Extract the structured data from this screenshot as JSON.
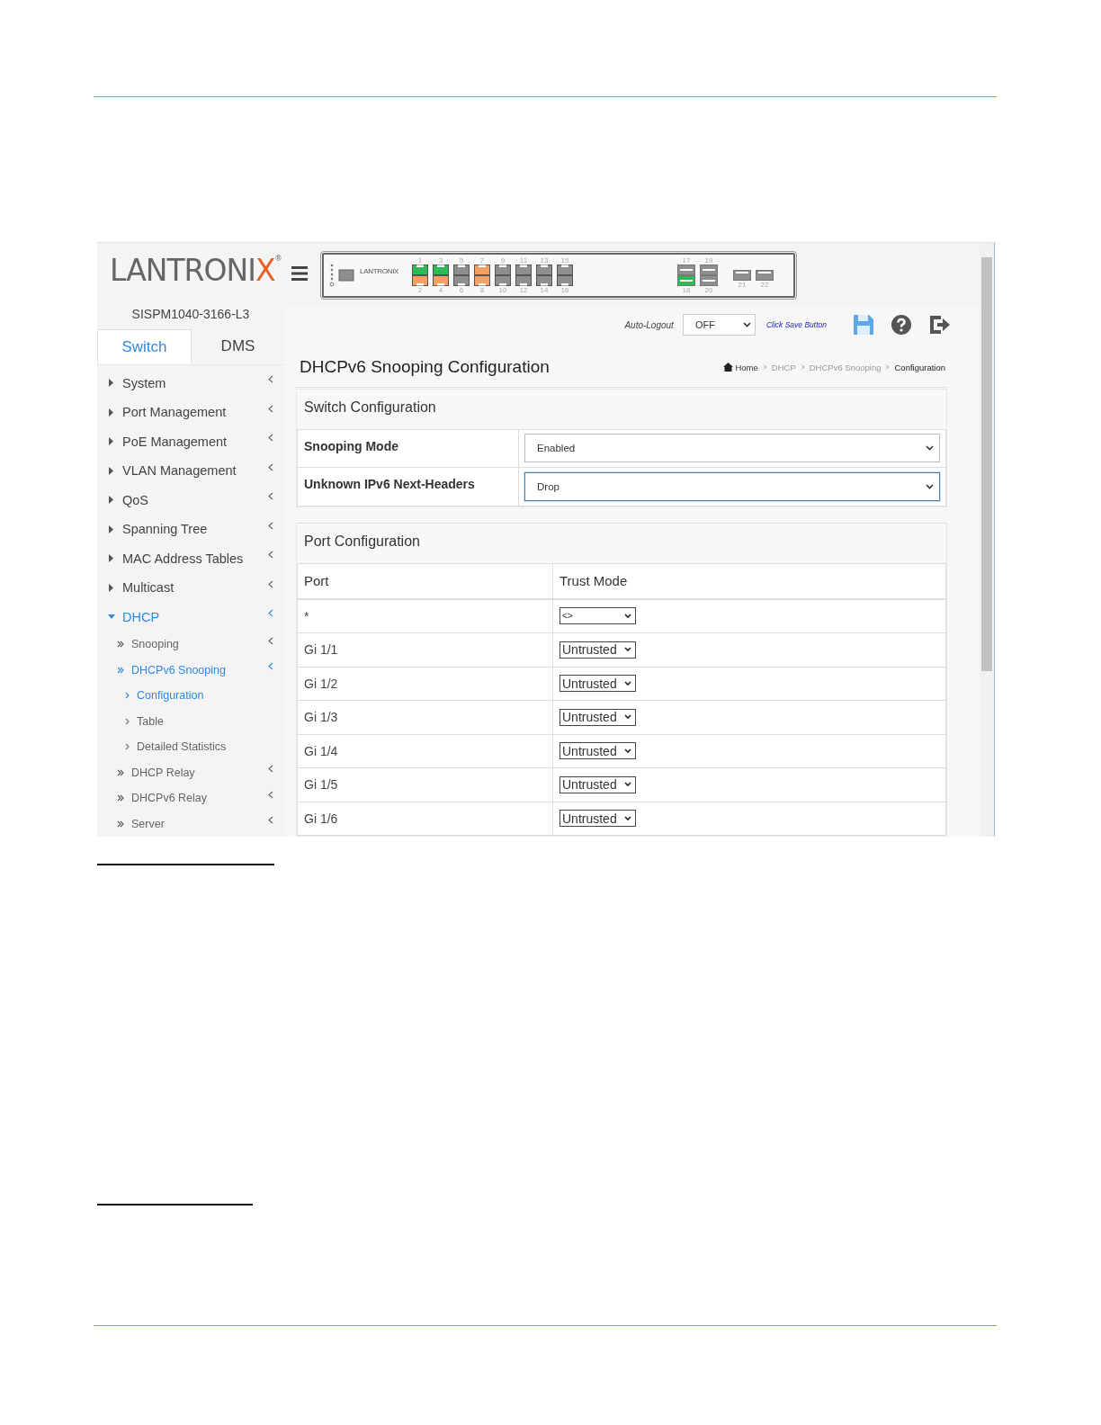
{
  "logo": {
    "text": "LANTRONI",
    "accent": "X",
    "mark": "®"
  },
  "switch_panel": {
    "logo_text": "LANTRONIX",
    "port_columns": [
      {
        "kind": "rj45",
        "top": {
          "label": "1",
          "color": "#2dbb55"
        },
        "bottom": {
          "label": "2",
          "color": "#f4a062"
        }
      },
      {
        "kind": "rj45",
        "top": {
          "label": "3",
          "color": "#2dbb55"
        },
        "bottom": {
          "label": "4",
          "color": "#f4a062"
        }
      },
      {
        "kind": "rj45",
        "top": {
          "label": "5",
          "color": "#8e8e8e"
        },
        "bottom": {
          "label": "6",
          "color": "#8e8e8e"
        }
      },
      {
        "kind": "rj45",
        "top": {
          "label": "7",
          "color": "#f4a062"
        },
        "bottom": {
          "label": "8",
          "color": "#f4a062"
        }
      },
      {
        "kind": "rj45",
        "top": {
          "label": "9",
          "color": "#8e8e8e"
        },
        "bottom": {
          "label": "10",
          "color": "#8e8e8e"
        }
      },
      {
        "kind": "rj45",
        "top": {
          "label": "11",
          "color": "#8e8e8e"
        },
        "bottom": {
          "label": "12",
          "color": "#8e8e8e"
        }
      },
      {
        "kind": "rj45",
        "top": {
          "label": "13",
          "color": "#8e8e8e"
        },
        "bottom": {
          "label": "14",
          "color": "#8e8e8e"
        }
      },
      {
        "kind": "rj45",
        "top": {
          "label": "15",
          "color": "#8e8e8e"
        },
        "bottom": {
          "label": "16",
          "color": "#8e8e8e"
        }
      },
      {
        "kind": "sfp",
        "top": {
          "label": "17",
          "color": "#8e8e8e"
        },
        "bottom": {
          "label": "18",
          "color": "#2dbb55"
        }
      },
      {
        "kind": "sfp",
        "top": {
          "label": "19",
          "color": "#8e8e8e"
        },
        "bottom": {
          "label": "20",
          "color": "#8e8e8e"
        }
      },
      {
        "kind": "small",
        "bottom": {
          "label": "21",
          "color": "#8e8e8e"
        }
      },
      {
        "kind": "small",
        "bottom": {
          "label": "22",
          "color": "#8e8e8e"
        }
      }
    ]
  },
  "model_name": "SISPM1040-3166-L3",
  "tabs": [
    {
      "label": "Switch",
      "selected": true
    },
    {
      "label": "DMS",
      "selected": false
    }
  ],
  "toolbar": {
    "auto_logout_label": "Auto-Logout",
    "auto_logout_value": "OFF",
    "save_hint": "Click Save Button"
  },
  "page_title": "DHCPv6 Snooping Configuration",
  "breadcrumb": [
    {
      "label": "Home",
      "selected": false
    },
    {
      "label": "DHCP",
      "selected": false
    },
    {
      "label": "DHCPv6 Snooping",
      "selected": false
    },
    {
      "label": "Configuration",
      "selected": true
    }
  ],
  "sidebar": {
    "items": [
      {
        "label": "System",
        "expanded": false
      },
      {
        "label": "Port Management",
        "expanded": false
      },
      {
        "label": "PoE Management",
        "expanded": false
      },
      {
        "label": "VLAN Management",
        "expanded": false
      },
      {
        "label": "QoS",
        "expanded": false
      },
      {
        "label": "Spanning Tree",
        "expanded": false
      },
      {
        "label": "MAC Address Tables",
        "expanded": false
      },
      {
        "label": "Multicast",
        "expanded": false
      },
      {
        "label": "DHCP",
        "expanded": true,
        "children": [
          {
            "label": "Snooping",
            "expanded": false
          },
          {
            "label": "DHCPv6 Snooping",
            "expanded": true,
            "children": [
              {
                "label": "Configuration",
                "selected": true
              },
              {
                "label": "Table",
                "selected": false
              },
              {
                "label": "Detailed Statistics",
                "selected": false
              }
            ]
          },
          {
            "label": "DHCP Relay",
            "expanded": false
          },
          {
            "label": "DHCPv6 Relay",
            "expanded": false
          },
          {
            "label": "Server",
            "expanded": false
          }
        ]
      }
    ]
  },
  "switch_configuration": {
    "title": "Switch Configuration",
    "rows": [
      {
        "label": "Snooping Mode",
        "value": "Enabled",
        "focused": false
      },
      {
        "label": "Unknown IPv6 Next-Headers",
        "value": "Drop",
        "focused": true
      }
    ]
  },
  "port_configuration": {
    "title": "Port Configuration",
    "columns": [
      "Port",
      "Trust Mode"
    ],
    "rows": [
      {
        "port": "*",
        "trust_mode": "<>"
      },
      {
        "port": "Gi 1/1",
        "trust_mode": "Untrusted"
      },
      {
        "port": "Gi 1/2",
        "trust_mode": "Untrusted"
      },
      {
        "port": "Gi 1/3",
        "trust_mode": "Untrusted"
      },
      {
        "port": "Gi 1/4",
        "trust_mode": "Untrusted"
      },
      {
        "port": "Gi 1/5",
        "trust_mode": "Untrusted"
      },
      {
        "port": "Gi 1/6",
        "trust_mode": "Untrusted"
      }
    ]
  }
}
